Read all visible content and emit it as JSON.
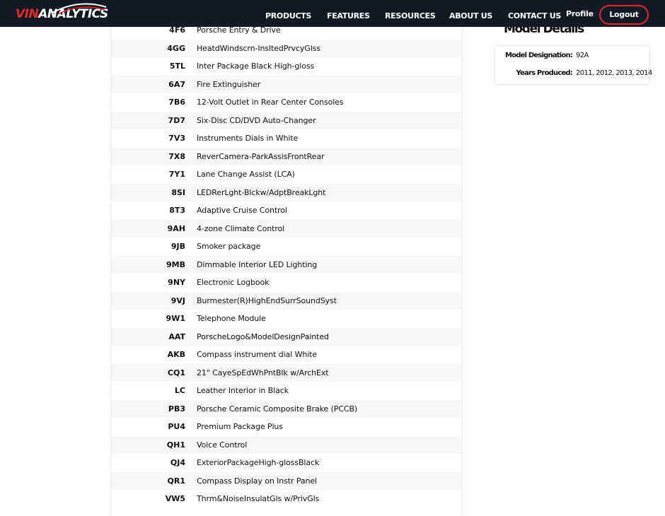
{
  "brand": {
    "logo_vin": "VIN",
    "logo_analytics": "ANALYTICS",
    "vin_color": "#e02a2a",
    "nav_bg": "#131a26"
  },
  "nav": {
    "products": "PRODUCTS",
    "features": "FEATURES",
    "resources": "RESOURCES",
    "about": "ABOUT US",
    "contact": "CONTACT US",
    "profile": "Profile",
    "logout": "Logout"
  },
  "options": [
    {
      "code": "4F6",
      "desc": "Porsche Entry & Drive"
    },
    {
      "code": "4GG",
      "desc": "HeatdWindscrn-InsltedPrvcyGlss"
    },
    {
      "code": "5TL",
      "desc": "Inter Package Black High-gloss"
    },
    {
      "code": "6A7",
      "desc": "Fire Extinguisher"
    },
    {
      "code": "7B6",
      "desc": "12-Volt Outlet in Rear Center Consoles"
    },
    {
      "code": "7D7",
      "desc": "Six-Disc CD/DVD Auto-Changer"
    },
    {
      "code": "7V3",
      "desc": "Instruments Dials in White"
    },
    {
      "code": "7X8",
      "desc": "ReverCamera-ParkAssisFrontRear"
    },
    {
      "code": "7Y1",
      "desc": "Lane Change Assist (LCA)"
    },
    {
      "code": "8SI",
      "desc": "LEDRerLght-Blckw/AdptBreakLght"
    },
    {
      "code": "8T3",
      "desc": "Adaptive Cruise Control"
    },
    {
      "code": "9AH",
      "desc": "4-zone Climate Control"
    },
    {
      "code": "9JB",
      "desc": "Smoker package"
    },
    {
      "code": "9MB",
      "desc": "Dimmable Interior LED Lighting"
    },
    {
      "code": "9NY",
      "desc": "Electronic Logbook"
    },
    {
      "code": "9VJ",
      "desc": "Burmester(R)HighEndSurrSoundSyst"
    },
    {
      "code": "9W1",
      "desc": "Telephone Module"
    },
    {
      "code": "AAT",
      "desc": "PorscheLogo&ModelDesignPainted"
    },
    {
      "code": "AKB",
      "desc": "Compass instrument dial White"
    },
    {
      "code": "CQ1",
      "desc": "21\" CayeSpEdWhPntBlk w/ArchExt"
    },
    {
      "code": "LC",
      "desc": "Leather Interior in Black"
    },
    {
      "code": "PB3",
      "desc": "Porsche Ceramic Composite Brake (PCCB)"
    },
    {
      "code": "PU4",
      "desc": "Premium Package Plus"
    },
    {
      "code": "QH1",
      "desc": "Voice Control"
    },
    {
      "code": "QJ4",
      "desc": "ExteriorPackageHigh-glossBlack"
    },
    {
      "code": "QR1",
      "desc": "Compass Display on Instr Panel"
    },
    {
      "code": "VW5",
      "desc": "Thrm&NoiseInsulatGls w/PrivGls"
    }
  ],
  "model_details": {
    "title": "Model Details",
    "designation_label": "Model Designation:",
    "designation_value": "92A",
    "years_label": "Years Produced:",
    "years_value": "2011, 2012, 2013, 2014"
  }
}
